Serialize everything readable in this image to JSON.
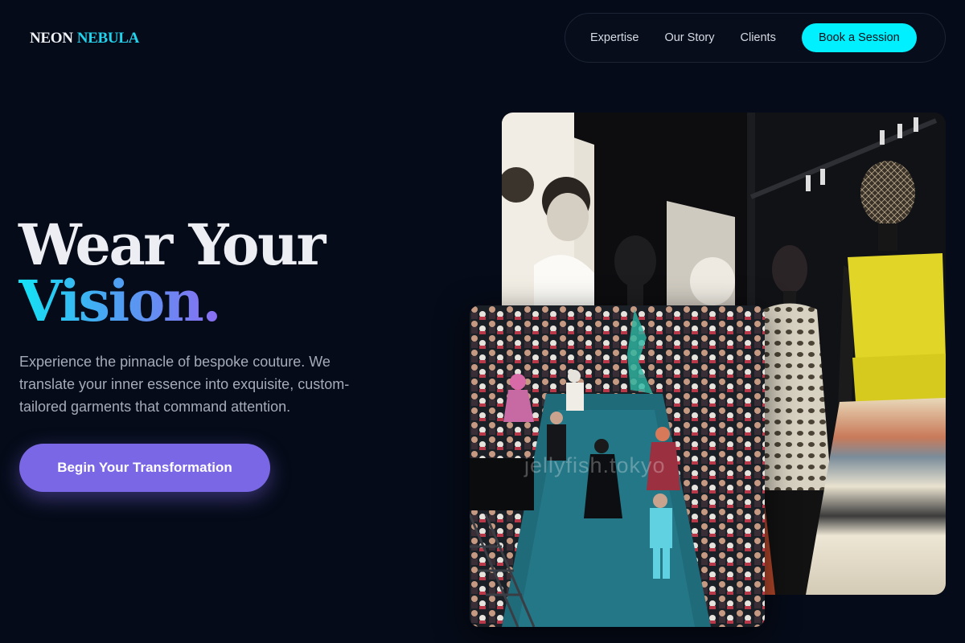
{
  "brand": {
    "word1": "NEON",
    "word2": "NEBULA"
  },
  "nav": {
    "links": [
      "Expertise",
      "Our Story",
      "Clients"
    ],
    "cta": "Book a Session"
  },
  "hero": {
    "title_line1": "Wear Your",
    "title_line2": "Vision.",
    "subtitle": "Experience the pinnacle of bespoke couture. We translate your inner essence into exquisite, custom-tailored garments that command attention.",
    "button": "Begin Your Transformation"
  },
  "gallery": {
    "watermark": "jellyfish.tokyo"
  },
  "colors": {
    "background": "#050b18",
    "accent_cyan": "#00f0ff",
    "accent_purple": "#7a67e6"
  }
}
